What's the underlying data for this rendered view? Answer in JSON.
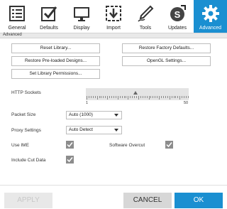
{
  "toolbar": {
    "tabs": [
      {
        "label": "General",
        "icon": "list-icon"
      },
      {
        "label": "Defaults",
        "icon": "checkbox-icon"
      },
      {
        "label": "Display",
        "icon": "monitor-icon"
      },
      {
        "label": "Import",
        "icon": "import-icon"
      },
      {
        "label": "Tools",
        "icon": "pen-icon"
      },
      {
        "label": "Updates",
        "icon": "updates-icon"
      },
      {
        "label": "Advanced",
        "icon": "gear-icon",
        "active": true
      }
    ]
  },
  "subheader": "Advanced",
  "buttons": {
    "reset_library": "Reset Library...",
    "restore_factory": "Restore Factory Defaults...",
    "restore_preloaded": "Restore Pre-loaded Designs...",
    "opengl": "OpenGL Settings...",
    "library_permissions": "Set Library Permissions..."
  },
  "http_sockets": {
    "label": "HTTP Sockets",
    "min": "1",
    "max": "50",
    "value": 26
  },
  "packet_size": {
    "label": "Packet Size",
    "value": "Auto (1000)"
  },
  "proxy": {
    "label": "Proxy Settings",
    "value": "Auto Detect"
  },
  "use_ime": {
    "label": "Use IME",
    "checked": true
  },
  "software_overcut": {
    "label": "Software Overcut",
    "checked": true
  },
  "include_cut_data": {
    "label": "Include Cut Data",
    "checked": true
  },
  "footer": {
    "apply": "APPLY",
    "cancel": "CANCEL",
    "ok": "OK"
  },
  "colors": {
    "accent": "#1a8fd1"
  }
}
